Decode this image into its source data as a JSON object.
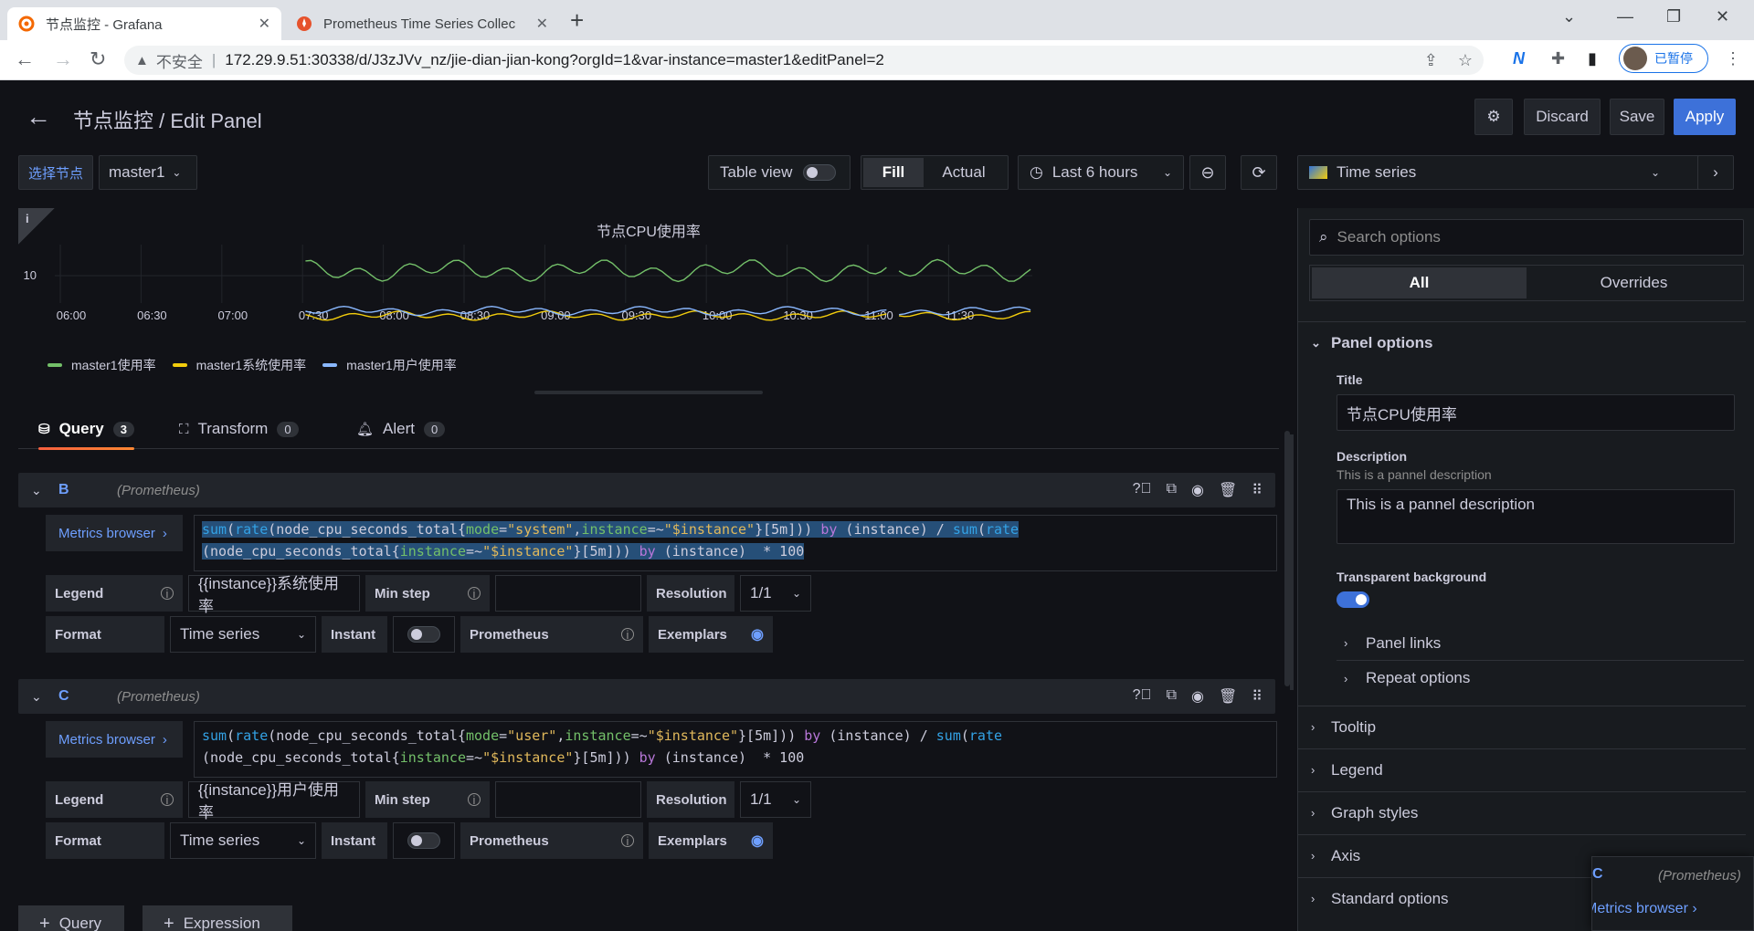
{
  "browser": {
    "tabs": [
      {
        "title": "节点监控 - Grafana",
        "active": true
      },
      {
        "title": "Prometheus Time Series Collec",
        "active": false
      }
    ],
    "address": {
      "insecure_label": "不安全",
      "url": "172.29.9.51:30338/d/J3zJVv_nz/jie-dian-jian-kong?orgId=1&var-instance=master1&editPanel=2"
    },
    "profile_label": "已暂停"
  },
  "header": {
    "title": "节点监控 / Edit Panel",
    "discard": "Discard",
    "save": "Save",
    "apply": "Apply"
  },
  "toolbar": {
    "variable_label": "选择节点",
    "variable_value": "master1",
    "table_view": "Table view",
    "fill": "Fill",
    "actual": "Actual",
    "time_range": "Last 6 hours",
    "visualization": "Time series"
  },
  "panel": {
    "info_icon": "i",
    "title": "节点CPU使用率"
  },
  "chart_data": {
    "type": "line",
    "title": "节点CPU使用率",
    "x_ticks": [
      "06:00",
      "06:30",
      "07:00",
      "07:30",
      "08:00",
      "08:30",
      "09:00",
      "09:30",
      "10:00",
      "10:30",
      "11:00",
      "11:30"
    ],
    "y_ticks": [
      "10"
    ],
    "series": [
      {
        "name": "master1使用率",
        "color": "#73bf69",
        "level": 10.5
      },
      {
        "name": "master1系统使用率",
        "color": "#f2cc0c",
        "level": 7.6
      },
      {
        "name": "master1用户使用率",
        "color": "#8ab8ff",
        "level": 7.9
      }
    ],
    "grid": true,
    "legend_position": "bottom-left"
  },
  "query_tabs": [
    {
      "label": "Query",
      "count": "3",
      "icon": "database-icon"
    },
    {
      "label": "Transform",
      "count": "0",
      "icon": "transform-icon"
    },
    {
      "label": "Alert",
      "count": "0",
      "icon": "bell-icon"
    }
  ],
  "queries": [
    {
      "ref": "B",
      "datasource": "(Prometheus)",
      "metrics_browser": "Metrics browser",
      "legend_label": "Legend",
      "legend_value": "{{instance}}系统使用率",
      "min_step_label": "Min step",
      "resolution_label": "Resolution",
      "resolution_value": "1/1",
      "format_label": "Format",
      "format_value": "Time series",
      "instant_label": "Instant",
      "prometheus_label": "Prometheus",
      "exemplars_label": "Exemplars"
    },
    {
      "ref": "C",
      "datasource": "(Prometheus)",
      "metrics_browser": "Metrics browser",
      "legend_label": "Legend",
      "legend_value": "{{instance}}用户使用率",
      "min_step_label": "Min step",
      "resolution_label": "Resolution",
      "resolution_value": "1/1",
      "format_label": "Format",
      "format_value": "Time series",
      "instant_label": "Instant",
      "prometheus_label": "Prometheus",
      "exemplars_label": "Exemplars"
    }
  ],
  "add_buttons": {
    "query": "Query",
    "expression": "Expression"
  },
  "options": {
    "search_placeholder": "Search options",
    "tab_all": "All",
    "tab_overrides": "Overrides",
    "panel_options": "Panel options",
    "title_label": "Title",
    "title_value": "节点CPU使用率",
    "description_label": "Description",
    "description_hint": "This is a pannel description",
    "description_value": "This is a pannel description",
    "transparent_label": "Transparent background",
    "panel_links": "Panel links",
    "repeat_options": "Repeat options",
    "sections": [
      "Tooltip",
      "Legend",
      "Graph styles",
      "Axis",
      "Standard options"
    ]
  },
  "drag_ghost": {
    "ref": "C",
    "datasource": "(Prometheus)",
    "metrics_browser": "Metrics browser"
  }
}
